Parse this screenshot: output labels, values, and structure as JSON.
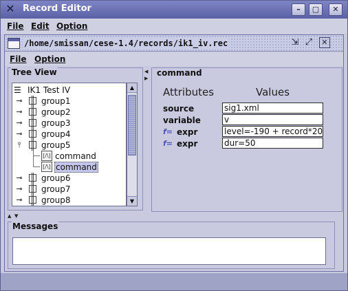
{
  "window": {
    "title": "Record Editor",
    "buttons": {
      "minimize": "–",
      "maximize": "▢",
      "close": "✕"
    }
  },
  "menubar": {
    "items": [
      {
        "label": "File",
        "mnemonic": "F"
      },
      {
        "label": "Edit",
        "mnemonic": "E"
      },
      {
        "label": "Option",
        "mnemonic": "O"
      }
    ]
  },
  "internal_frame": {
    "title": "/home/smissan/cese-1.4/records/ik1_iv.rec",
    "menubar": {
      "items": [
        {
          "label": "File",
          "mnemonic": "F"
        },
        {
          "label": "Option",
          "mnemonic": "O"
        }
      ]
    }
  },
  "tree_view": {
    "title": "Tree View",
    "root": "IK1 Test IV",
    "groups": [
      "group1",
      "group2",
      "group3",
      "group4",
      "group5",
      "group6",
      "group7",
      "group8"
    ],
    "expanded_group": "group5",
    "children": [
      "command",
      "command"
    ],
    "selected_child_index": 1,
    "scroll_position_fraction": 0.1
  },
  "command_panel": {
    "title": "command",
    "headers": {
      "attributes": "Attributes",
      "values": "Values"
    },
    "rows": [
      {
        "name": "source",
        "value": "sig1.xml",
        "is_function": false
      },
      {
        "name": "variable",
        "value": "v",
        "is_function": false
      },
      {
        "name": "expr",
        "value": "level=-190 + record*20",
        "is_function": true
      },
      {
        "name": "expr",
        "value": "dur=50",
        "is_function": true
      }
    ],
    "function_badge": "f="
  },
  "messages": {
    "title": "Messages",
    "content": ""
  },
  "colors": {
    "titlebar": "#5a61a6",
    "selection": "#c3c6ea",
    "background": "#c9c9df"
  }
}
